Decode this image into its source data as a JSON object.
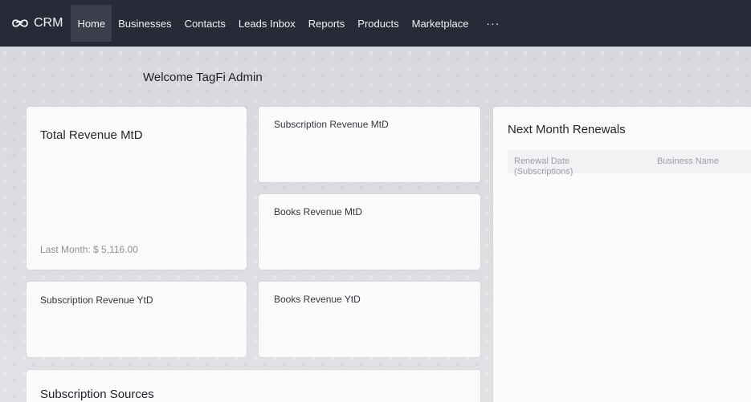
{
  "brand": {
    "name": "CRM",
    "icon": "crm-logo-icon"
  },
  "nav": {
    "items": [
      {
        "label": "Home",
        "active": true
      },
      {
        "label": "Businesses"
      },
      {
        "label": "Contacts"
      },
      {
        "label": "Leads Inbox"
      },
      {
        "label": "Reports"
      },
      {
        "label": "Products"
      },
      {
        "label": "Marketplace"
      }
    ],
    "more": "···"
  },
  "welcome": "Welcome TagFi Admin",
  "cards": {
    "total_revenue_mtd": {
      "title": "Total Revenue MtD",
      "last_month": "Last Month: $ 5,116.00"
    },
    "subscription_revenue_mtd": {
      "title": "Subscription Revenue MtD"
    },
    "books_revenue_mtd": {
      "title": "Books Revenue MtD"
    },
    "subscription_revenue_ytd": {
      "title": "Subscription Revenue YtD"
    },
    "books_revenue_ytd": {
      "title": "Books Revenue YtD"
    },
    "subscription_sources": {
      "title": "Subscription Sources"
    },
    "next_month_renewals": {
      "title": "Next Month Renewals",
      "columns": [
        "Renewal Date (Subscriptions)",
        "Business Name"
      ]
    }
  },
  "colors": {
    "navbar": "#262b37",
    "nav_active": "#3a3f4b",
    "background": "#d9dadf",
    "card": "#fbfbfc"
  }
}
